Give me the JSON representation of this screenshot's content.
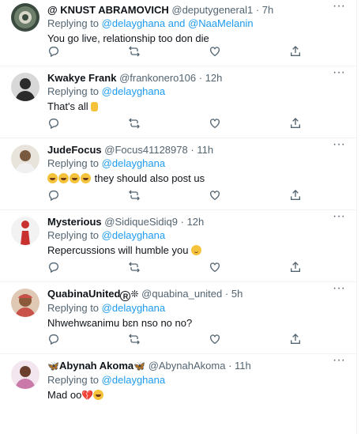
{
  "replying_to_label": "Replying to",
  "more_glyph": "···",
  "tweets": [
    {
      "name": "@ KNUST ABRAMOVICH",
      "handle": "@deputygeneral1",
      "time": "7h",
      "mentions": "@delayghana and @NaaMelanin",
      "text": "You go live, relationship too don die",
      "avatar_color": "#3a4a3e"
    },
    {
      "name": "Kwakye Frank",
      "handle": "@frankonero106",
      "time": "12h",
      "mentions": "@delayghana",
      "text": "That's all",
      "text_emoji": "waving-hand",
      "avatar_color": "#2b2b2b"
    },
    {
      "name": "JudeFocus",
      "handle": "@Focus41128978",
      "time": "11h",
      "mentions": "@delayghana",
      "text": "they should also post us",
      "text_emoji": "laughing-x4",
      "avatar_color": "#7a5a3e"
    },
    {
      "name": "Mysterious",
      "handle": "@SidiqueSidiq9",
      "time": "12h",
      "mentions": "@delayghana",
      "text": "Repercussions will humble you",
      "text_emoji": "relieved-face",
      "avatar_color": "#c93030"
    },
    {
      "name": "QuabinaUnited",
      "handle": "@quabina_united",
      "time": "5h",
      "mentions": "@delayghana",
      "text": "Nhwehwɛanimu bɛn nso no no?",
      "avatar_color": "#c9534b"
    },
    {
      "name": "Abynah Akoma",
      "handle": "@AbynahAkoma",
      "time": "11h",
      "mentions": "@delayghana",
      "text": "Mad oo",
      "text_emoji": "broken-heart-laughing",
      "avatar_color": "#c97aa8"
    }
  ],
  "action_icons": [
    "reply-icon",
    "retweet-icon",
    "like-icon",
    "share-icon"
  ],
  "colors": {
    "link": "#1d9bf0",
    "muted": "#536471",
    "divider": "#eff3f4"
  }
}
